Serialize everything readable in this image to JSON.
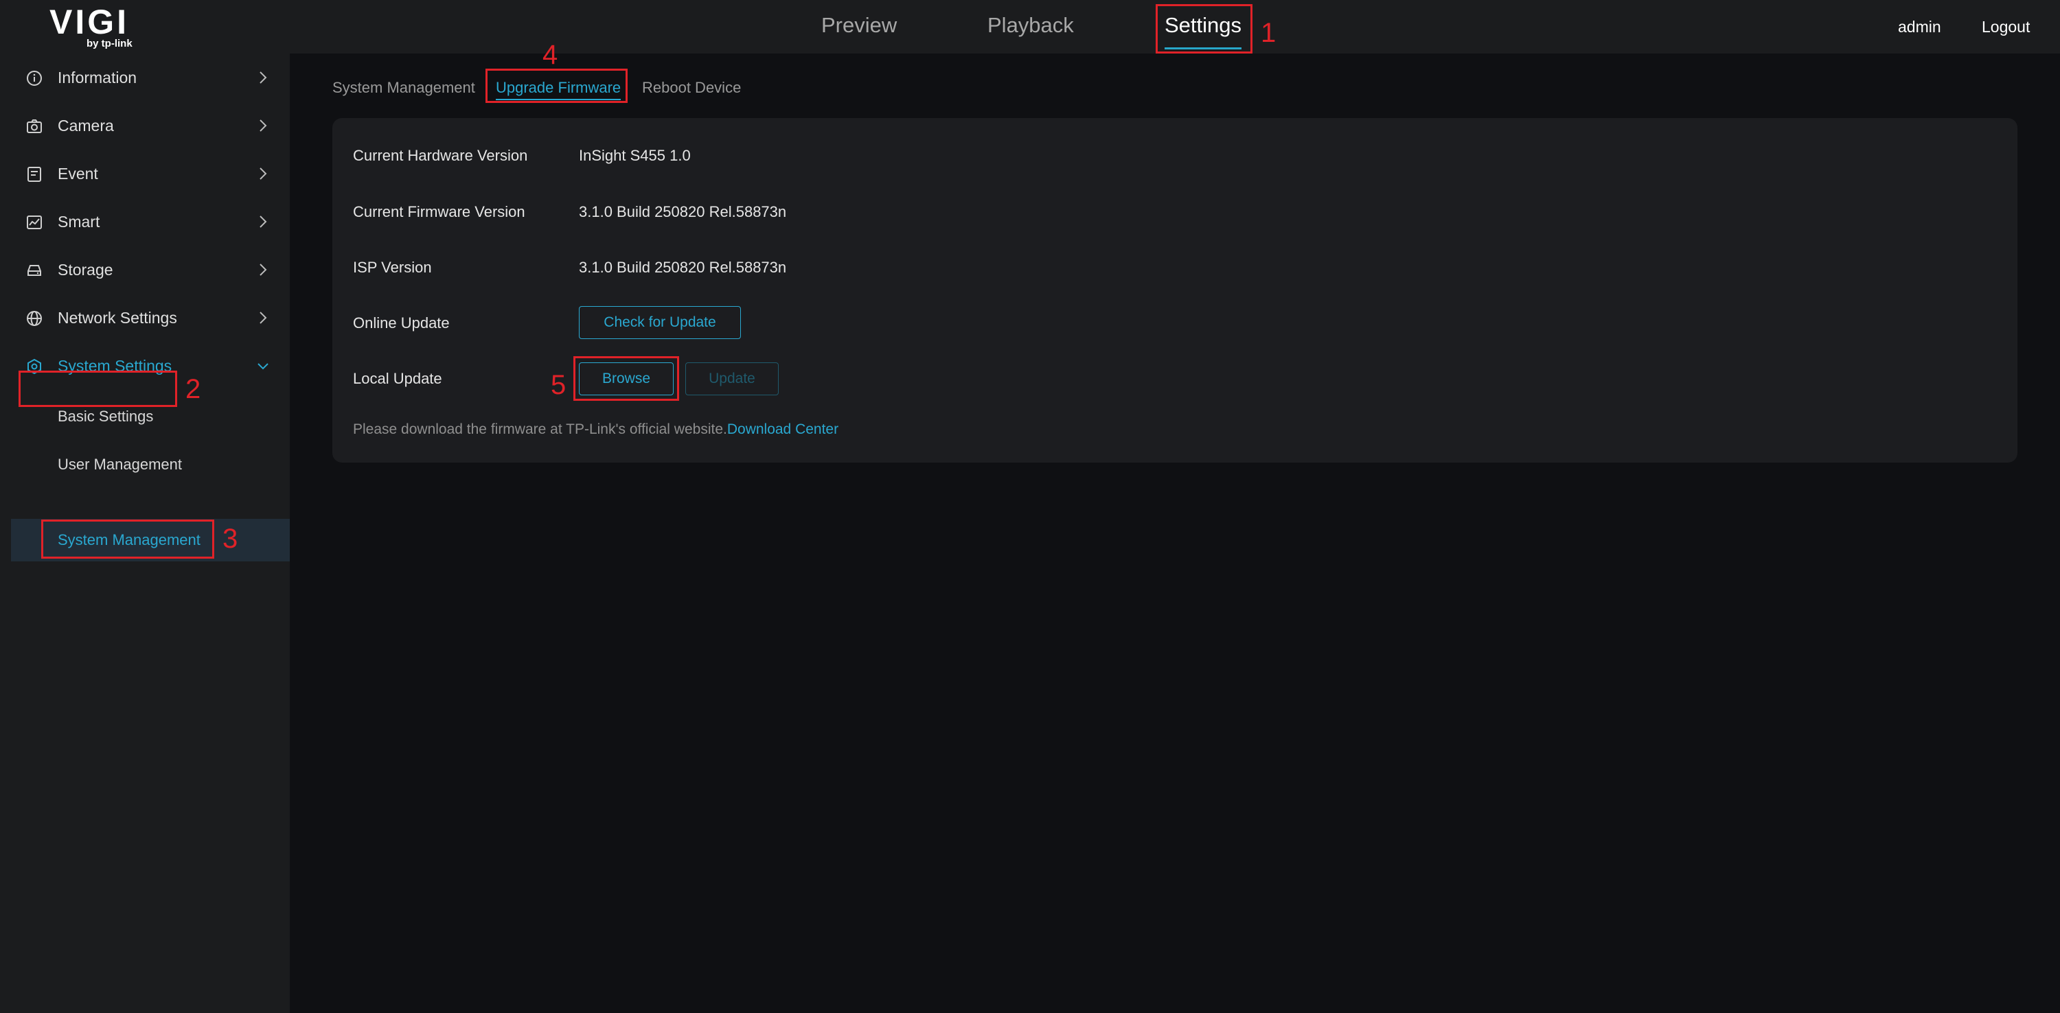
{
  "header": {
    "logo_main": "VIGI",
    "logo_sub": "by tp-link",
    "nav": [
      "Preview",
      "Playback",
      "Settings"
    ],
    "active_nav": "Settings",
    "user": "admin",
    "logout": "Logout"
  },
  "sidebar": {
    "items": [
      {
        "label": "Information",
        "icon": "info-icon"
      },
      {
        "label": "Camera",
        "icon": "camera-icon"
      },
      {
        "label": "Event",
        "icon": "event-icon"
      },
      {
        "label": "Smart",
        "icon": "smart-icon"
      },
      {
        "label": "Storage",
        "icon": "storage-icon"
      },
      {
        "label": "Network Settings",
        "icon": "globe-icon"
      },
      {
        "label": "System Settings",
        "icon": "system-icon"
      }
    ],
    "subitems": [
      "Basic Settings",
      "User Management",
      "System Management"
    ],
    "active_item": "System Settings",
    "active_subitem": "System Management"
  },
  "tabs": [
    "System Management",
    "Upgrade Firmware",
    "Reboot Device"
  ],
  "active_tab": "Upgrade Firmware",
  "firmware": {
    "hardware_label": "Current Hardware Version",
    "hardware_value": "InSight S455 1.0",
    "firmware_label": "Current Firmware Version",
    "firmware_value": "3.1.0 Build 250820 Rel.58873n",
    "isp_label": "ISP Version",
    "isp_value": "3.1.0 Build 250820 Rel.58873n",
    "online_label": "Online Update",
    "check_button": "Check for Update",
    "local_label": "Local Update",
    "browse_button": "Browse",
    "update_button": "Update",
    "note_text": "Please download the firmware at TP-Link's official website.",
    "download_link": "Download Center"
  },
  "annotations": [
    "1",
    "2",
    "3",
    "4",
    "5"
  ],
  "colors": {
    "accent": "#2aa8d0",
    "annotation": "#e02228",
    "background": "#0f1013",
    "panel": "#1b1c1e"
  }
}
